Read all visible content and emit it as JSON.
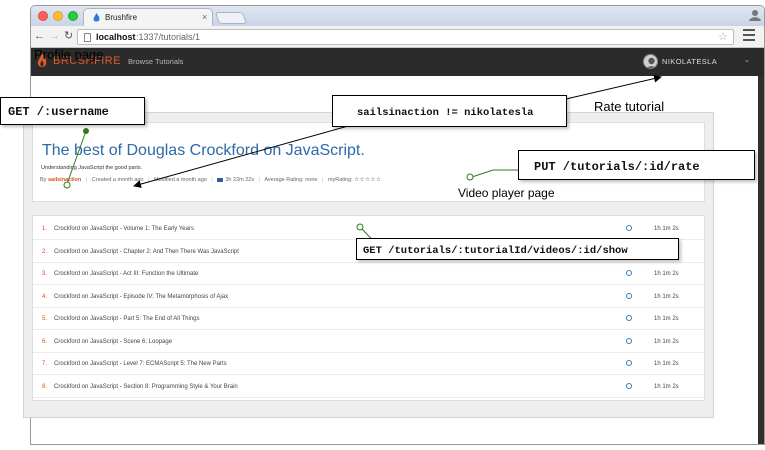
{
  "browser": {
    "tab_title": "Brushfire",
    "tab_close": "×",
    "url_host": "localhost",
    "url_path": ":1337/tutorials/1",
    "icons": [
      "back-icon",
      "forward-icon",
      "reload-icon",
      "page-icon",
      "bookmark-star-icon",
      "menu-icon"
    ]
  },
  "navbar": {
    "brand": "BRUSHFIRE",
    "browse_link": "Browse Tutorials",
    "username": "NIKOLATESLA",
    "caret": "⌄",
    "brand_color": "#e05a2b"
  },
  "tutorial": {
    "title": "The best of Douglas Crockford on JavaScript.",
    "description": "Understanding JavaScript the good parts.",
    "by_label": "By",
    "author": "sailsinaction",
    "created": "Created a month ago",
    "modified": "Modified a month ago",
    "length": "3h 22m 22s",
    "average_rating": "Average Rating: none",
    "my_rating_label": "myRating:",
    "my_rating_stars": "☆☆☆☆☆"
  },
  "videos": [
    {
      "num": "1.",
      "name": "Crockford on JavaScript - Volume 1: The Early Years",
      "duration": "1h 1m 2s"
    },
    {
      "num": "2.",
      "name": "Crockford on JavaScript - Chapter 2: And Then There Was JavaScript",
      "duration": "1h 1m 2s"
    },
    {
      "num": "3.",
      "name": "Crockford on JavaScript - Act III: Function the Ultimate",
      "duration": "1h 1m 2s"
    },
    {
      "num": "4.",
      "name": "Crockford on JavaScript - Episode IV: The Metamorphosis of Ajax",
      "duration": "1h 1m 2s"
    },
    {
      "num": "5.",
      "name": "Crockford on JavaScript - Part 5: The End of All Things",
      "duration": "1h 1m 2s"
    },
    {
      "num": "6.",
      "name": "Crockford on JavaScript - Scene 6: Loopage",
      "duration": "1h 1m 2s"
    },
    {
      "num": "7.",
      "name": "Crockford on JavaScript - Level 7: ECMAScript 5: The New Parts",
      "duration": "1h 1m 2s"
    },
    {
      "num": "8.",
      "name": "Crockford on JavaScript - Section 8: Programming Style & Your Brain",
      "duration": "1h 1m 2s"
    }
  ],
  "annotations": {
    "profile_page": "Profile page",
    "rate_tutorial": "Rate tutorial",
    "video_player_page": "Video player page",
    "get_username": "GET /:username",
    "sails_neq": "sailsinaction != nikolatesla",
    "put_rate": "PUT /tutorials/:id/rate",
    "get_video_show": "GET /tutorials/:tutorialId/videos/:id/show",
    "connector_color": "#2f7a1f"
  }
}
